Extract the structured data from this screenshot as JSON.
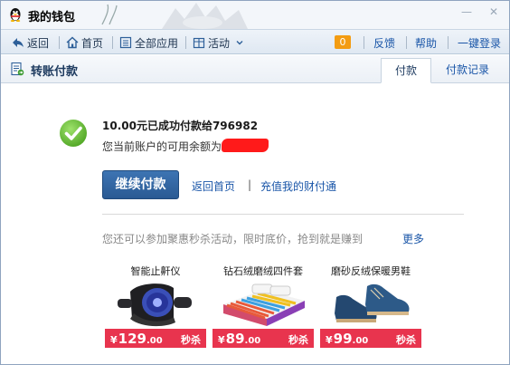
{
  "window": {
    "title": "我的钱包",
    "controls": {
      "minimize": "—",
      "close": "✕"
    }
  },
  "toolbar": {
    "back": "返回",
    "home": "首页",
    "all_apps": "全部应用",
    "activity": "活动",
    "badge_count": "0",
    "feedback": "反馈",
    "help": "帮助",
    "login": "一键登录"
  },
  "section": {
    "title": "转账付款",
    "tabs": [
      "付款",
      "付款记录"
    ]
  },
  "result": {
    "success_message": "10.00元已成功付款给796982",
    "balance_label": "您当前账户的可用余额为"
  },
  "actions": {
    "continue_label": "继续付款",
    "back_home": "返回首页",
    "separator": "|",
    "recharge": "充值我的财付通"
  },
  "promo": {
    "text": "您还可以参加聚惠秒杀活动，限时底价，抢到就是赚到",
    "more": "更多",
    "products": [
      {
        "name": "智能止鼾仪",
        "currency": "¥",
        "price_int": "129",
        "price_dec": ".00",
        "tag": "秒杀"
      },
      {
        "name": "钻石绒磨绒四件套",
        "currency": "¥",
        "price_int": "89",
        "price_dec": ".00",
        "tag": "秒杀"
      },
      {
        "name": "磨砂反绒保暖男鞋",
        "currency": "¥",
        "price_int": "99",
        "price_dec": ".00",
        "tag": "秒杀"
      }
    ]
  },
  "colors": {
    "accent": "#2a5a93",
    "link": "#1a56a8",
    "price_bar": "#e8344e",
    "badge": "#f39c12",
    "success": "#6bbf3a"
  }
}
